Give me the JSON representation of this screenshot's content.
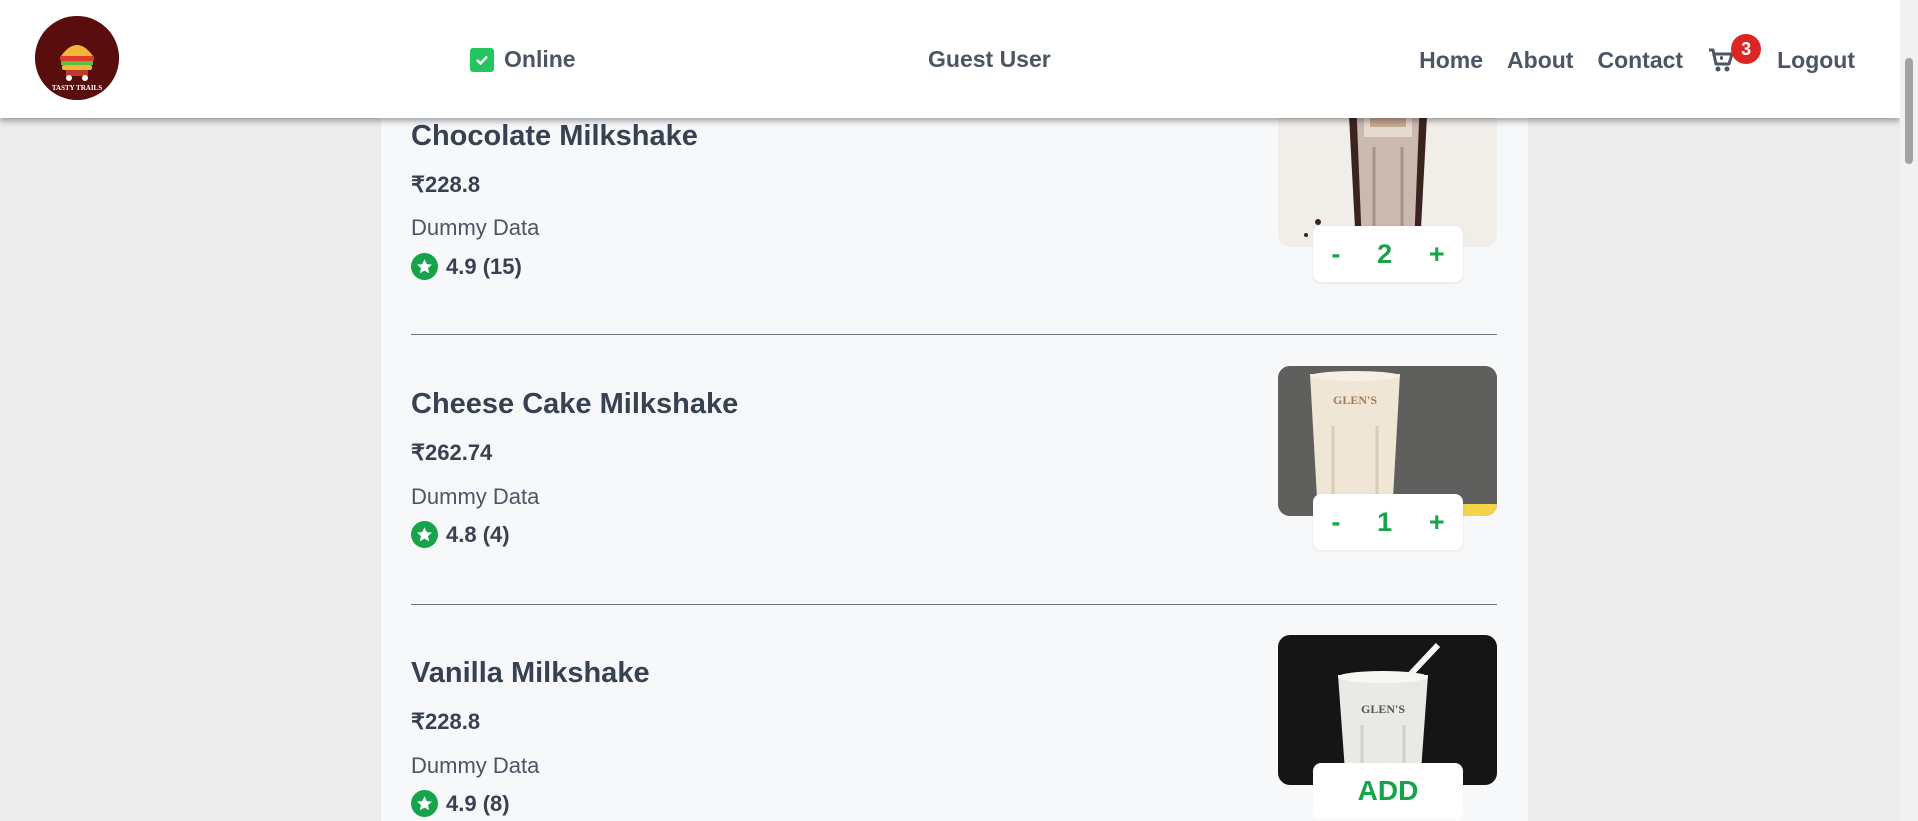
{
  "header": {
    "logo_text": "TASTY TRAILS",
    "status_label": "Online",
    "user_name": "Guest User",
    "nav": [
      "Home",
      "About",
      "Contact"
    ],
    "cart_count": "3",
    "logout_label": "Logout"
  },
  "colors": {
    "accent": "#16a34a",
    "badge": "#dc2626",
    "status": "#22c55e"
  },
  "items": [
    {
      "name": "Chocolate Milkshake",
      "price": "₹228.8",
      "description": "Dummy Data",
      "rating": "4.9 (15)",
      "quantity": "2",
      "minus": "-",
      "plus": "+"
    },
    {
      "name": "Cheese Cake Milkshake",
      "price": "₹262.74",
      "description": "Dummy Data",
      "rating": "4.8 (4)",
      "quantity": "1",
      "minus": "-",
      "plus": "+"
    },
    {
      "name": "Vanilla Milkshake",
      "price": "₹228.8",
      "description": "Dummy Data",
      "rating": "4.9 (8)",
      "add_label": "ADD"
    }
  ]
}
